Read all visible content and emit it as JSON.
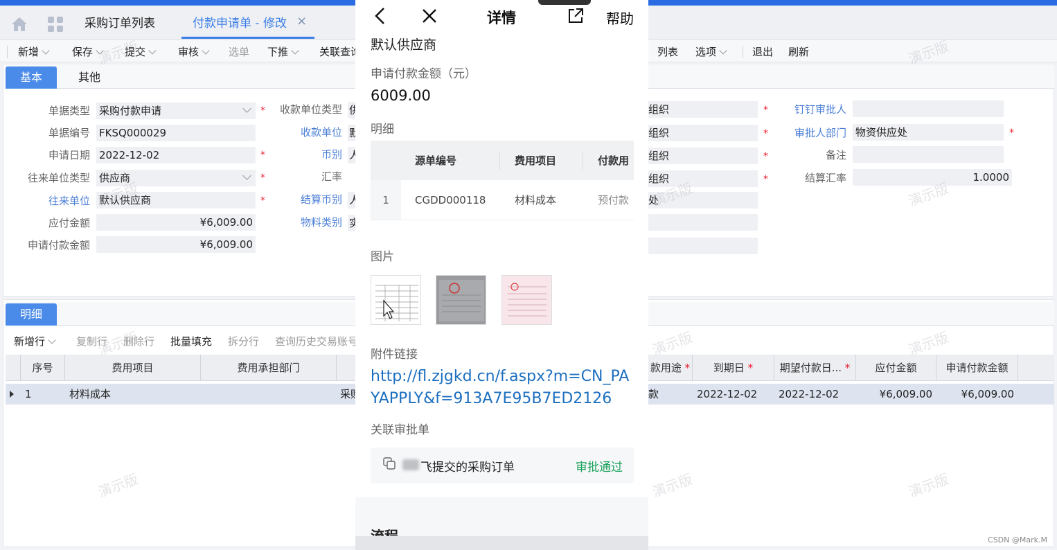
{
  "tabs": {
    "purchase_order_list": "采购订单列表",
    "payment_request_edit": "付款申请单 - 修改",
    "close": "×"
  },
  "toolbar": {
    "new": "新增",
    "save": "保存",
    "submit": "提交",
    "audit": "审核",
    "select": "选单",
    "push": "下推",
    "related_query": "关联查询",
    "list": "列表",
    "options": "选项",
    "exit": "退出",
    "refresh": "刷新"
  },
  "header_tabs": {
    "basic": "基本",
    "other": "其他"
  },
  "form": {
    "doc_type_label": "单据类型",
    "doc_type_value": "采购付款申请",
    "doc_no_label": "单据编号",
    "doc_no_value": "FKSQ000029",
    "apply_date_label": "申请日期",
    "apply_date_value": "2022-12-02",
    "partner_type_label": "往来单位类型",
    "partner_type_value": "供应商",
    "partner_label": "往来单位",
    "partner_value": "默认供应商",
    "payable_label": "应付金额",
    "payable_value": "¥6,009.00",
    "request_amount_label": "申请付款金额",
    "request_amount_value": "¥6,009.00",
    "payee_type_label": "收款单位类型",
    "payee_type_value": "供",
    "payee_label": "收款单位",
    "payee_value": "默",
    "currency_label": "币别",
    "currency_value": "人",
    "rate_label": "汇率",
    "settle_currency_label": "结算币别",
    "settle_currency_value": "人",
    "material_cat_label": "物料类别",
    "material_cat_value": "实",
    "org1_value": "组织",
    "org2_value": "组织",
    "org3_value": "组织",
    "org4_value": "组织",
    "dept_short_value": "处",
    "dingtalk_approver_label": "钉钉审批人",
    "dingtalk_approver_value": "",
    "approver_dept_label": "审批人部门",
    "approver_dept_value": "物资供应处",
    "remark_label": "备注",
    "remark_value": "",
    "settle_rate_label": "结算汇率",
    "settle_rate_value": "1.0000",
    "required": "*"
  },
  "detail_tab": "明细",
  "detail_toolbar": {
    "add_row": "新增行",
    "copy_row": "复制行",
    "delete_row": "删除行",
    "batch_fill": "批量填充",
    "split_row": "拆分行",
    "history": "查询历史交易账号"
  },
  "grid": {
    "headers": {
      "seq": "序号",
      "expense_item": "费用项目",
      "dept": "费用承担部门",
      "purpose": "款用途",
      "due_date": "到期日",
      "expected_date": "期望付款日...",
      "payable": "应付金额",
      "request_amount": "申请付款金额"
    },
    "row": {
      "seq": "1",
      "expense_item": "材料成本",
      "dept": "",
      "col_cut": "采购",
      "purpose": "款",
      "due_date": "2022-12-02",
      "expected_date": "2022-12-02",
      "payable": "¥6,009.00",
      "request_amount": "¥6,009.00"
    }
  },
  "watermark": "演示版",
  "mobile": {
    "title": "详情",
    "help": "帮助",
    "default_supplier": "默认供应商",
    "amount_label": "申请付款金额（元）",
    "amount_value": "6009.00",
    "detail_label": "明细",
    "table_headers": {
      "source_no": "源单编号",
      "expense_item": "费用项目",
      "payment_use": "付款用"
    },
    "table_row": {
      "index": "1",
      "source_no": "CGDD000118",
      "expense_item": "材料成本",
      "payment_use": "预付款"
    },
    "images_label": "图片",
    "attachment_label": "附件链接",
    "attachment_url": "http://fl.zjgkd.cn/f.aspx?m=CN_PAYAPPLY&f=913A7E95B7ED2126",
    "related_label": "关联审批单",
    "related_title": "飞提交的采购订单",
    "related_status": "审批通过",
    "process_label": "流程"
  },
  "footer": "CSDN @Mark.M"
}
